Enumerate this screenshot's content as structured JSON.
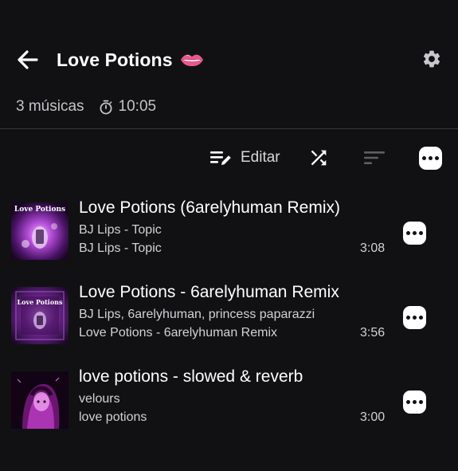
{
  "header": {
    "title": "Love Potions",
    "title_emoji_icon": "lips-icon",
    "back_icon": "arrow-left-icon",
    "settings_icon": "gear-icon"
  },
  "meta": {
    "song_count": "3 músicas",
    "duration_icon": "stopwatch-icon",
    "total_duration": "10:05"
  },
  "toolbar": {
    "edit_label": "Editar",
    "edit_icon": "edit-list-icon",
    "shuffle_icon": "shuffle-icon",
    "sort_icon": "sort-icon",
    "more_icon": "more-options-icon"
  },
  "colors": {
    "background": "#111113",
    "text_primary": "#ffffff",
    "text_secondary": "#d2d2d6",
    "divider": "#38383c",
    "sort_icon_disabled": "#5f5f63"
  },
  "tracks": [
    {
      "title": "Love Potions (6arelyhuman Remix)",
      "artist": "BJ Lips - Topic",
      "album": "BJ Lips - Topic",
      "duration": "3:08",
      "thumb_text": "Love Potions"
    },
    {
      "title": "Love Potions - 6arelyhuman Remix",
      "artist": "BJ Lips, 6arelyhuman, princess paparazzi",
      "album": "Love Potions - 6arelyhuman Remix",
      "duration": "3:56",
      "thumb_text": "Love Potions"
    },
    {
      "title": "love potions - slowed & reverb",
      "artist": "velours",
      "album": "love potions",
      "duration": "3:00"
    }
  ]
}
